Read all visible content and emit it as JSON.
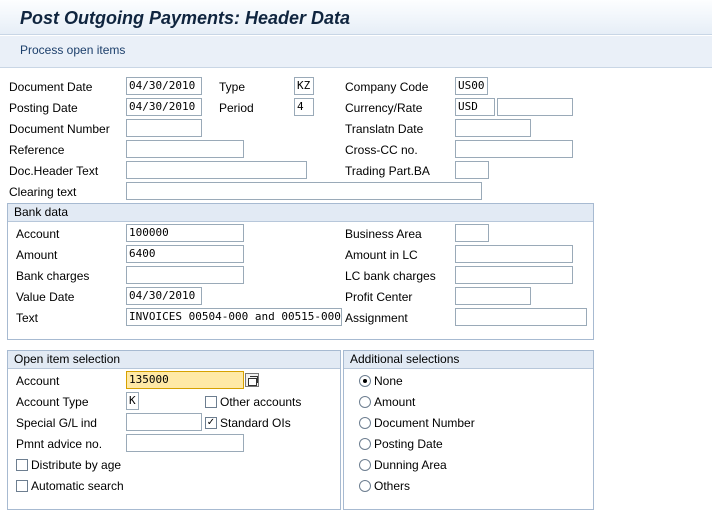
{
  "header": {
    "title": "Post Outgoing Payments: Header Data"
  },
  "toolbar": {
    "process_open_items": "Process open items"
  },
  "doc": {
    "document_date_label": "Document Date",
    "document_date": "04/30/2010",
    "type_label": "Type",
    "type": "KZ",
    "company_code_label": "Company Code",
    "company_code": "US00",
    "posting_date_label": "Posting Date",
    "posting_date": "04/30/2010",
    "period_label": "Period",
    "period": "4",
    "currency_rate_label": "Currency/Rate",
    "currency": "USD",
    "rate": "",
    "document_number_label": "Document Number",
    "document_number": "",
    "translatn_date_label": "Translatn Date",
    "translatn_date": "",
    "reference_label": "Reference",
    "reference": "",
    "cross_cc_label": "Cross-CC no.",
    "cross_cc": "",
    "doc_header_text_label": "Doc.Header Text",
    "doc_header_text": "",
    "trading_part_label": "Trading Part.BA",
    "trading_part": "",
    "clearing_text_label": "Clearing text",
    "clearing_text": ""
  },
  "bank": {
    "title": "Bank data",
    "account_label": "Account",
    "account": "100000",
    "business_area_label": "Business Area",
    "business_area": "",
    "amount_label": "Amount",
    "amount": "6400",
    "amount_lc_label": "Amount in LC",
    "amount_lc": "",
    "bank_charges_label": "Bank charges",
    "bank_charges": "",
    "lc_bank_charges_label": "LC bank charges",
    "lc_bank_charges": "",
    "value_date_label": "Value Date",
    "value_date": "04/30/2010",
    "profit_center_label": "Profit Center",
    "profit_center": "",
    "text_label": "Text",
    "text": "INVOICES 00504-000 and 00515-000",
    "assignment_label": "Assignment",
    "assignment": ""
  },
  "open_items": {
    "title": "Open item selection",
    "account_label": "Account",
    "account": "135000",
    "account_type_label": "Account Type",
    "account_type": "K",
    "other_accounts_label": "Other accounts",
    "other_accounts_checked": false,
    "special_gl_label": "Special G/L ind",
    "special_gl": "",
    "standard_ois_label": "Standard OIs",
    "standard_ois_checked": true,
    "pmnt_advice_label": "Pmnt advice no.",
    "pmnt_advice": "",
    "distribute_by_age_label": "Distribute by age",
    "distribute_by_age_checked": false,
    "automatic_search_label": "Automatic search",
    "automatic_search_checked": false
  },
  "additional": {
    "title": "Additional selections",
    "options": [
      "None",
      "Amount",
      "Document Number",
      "Posting Date",
      "Dunning Area",
      "Others"
    ],
    "selected": "None"
  },
  "colors": {
    "title": "#10253f",
    "group_header": "#e2eaf4",
    "highlight": "#ffe9a6"
  }
}
